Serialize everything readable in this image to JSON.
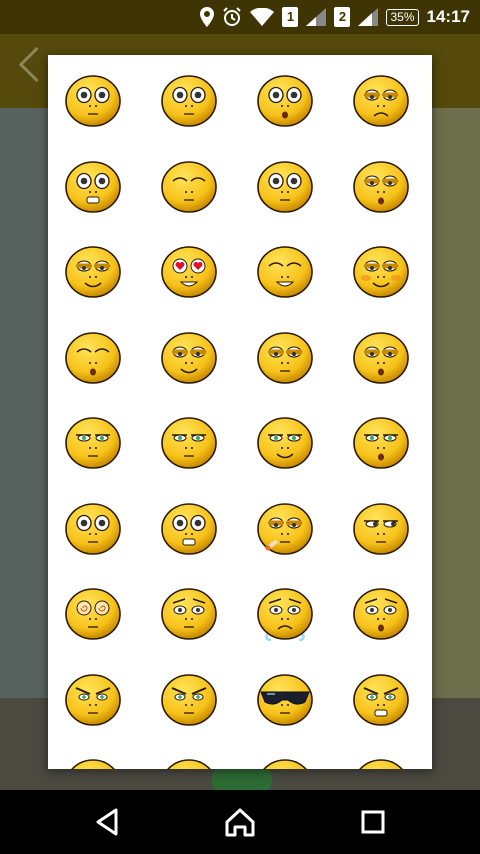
{
  "status_bar": {
    "sim1": "1",
    "sim2": "2",
    "battery": "35%",
    "time": "14:17",
    "icons": [
      "location-icon",
      "alarm-icon",
      "wifi-icon",
      "signal-icon",
      "signal-icon",
      "battery-icon"
    ]
  },
  "emoji_picker": {
    "rows": [
      [
        "wide-eyes",
        "wide-eyes",
        "wide-eyes-surprised",
        "sad-frown"
      ],
      [
        "grimace",
        "eyes-closed",
        "wide-eyes",
        "sleepy-oh"
      ],
      [
        "eye-roll-smile",
        "heart-eyes",
        "eyes-closed-smile",
        "blush-smirk"
      ],
      [
        "eyes-closed-oh",
        "sleepy-smile",
        "half-eyes",
        "half-eyes-oh"
      ],
      [
        "unimpressed",
        "unimpressed",
        "smug",
        "unimpressed-oh"
      ],
      [
        "wide-eyes",
        "nervous-grin",
        "smoking",
        "side-eye"
      ],
      [
        "dizzy",
        "worried",
        "crying",
        "worried-kiss"
      ],
      [
        "angry",
        "angry",
        "sunglasses",
        "angry-grin"
      ],
      [
        "partial",
        "partial",
        "partial",
        "partial"
      ]
    ]
  },
  "colors": {
    "face": "#f7c21a",
    "face_dark": "#c98a00",
    "outline": "#2a1a00"
  },
  "nav_bar": {
    "buttons": [
      "back-icon",
      "home-icon",
      "recents-icon"
    ]
  }
}
